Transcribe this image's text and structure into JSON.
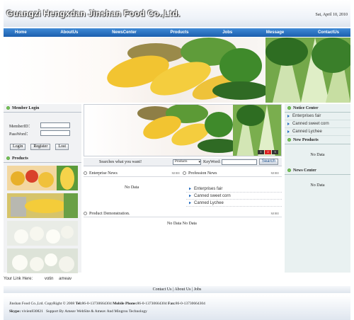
{
  "header": {
    "site_title": "Guangzi Hengxdan Jinshan Food Co.,Ltd.",
    "date": "Sat, April 10, 2010"
  },
  "nav": [
    "Home",
    "AboutUs",
    "NewsCenter",
    "Products",
    "Jobs",
    "Message",
    "ContactUs"
  ],
  "member_login": {
    "title": "Member Login",
    "member_id_label": "MemberID：",
    "password_label": "PassWord：",
    "login_button": "Login",
    "register_button": "Register",
    "lost_button": "Lost"
  },
  "products": {
    "title": "Products"
  },
  "slider": {
    "dots": [
      "1",
      "2",
      "3"
    ],
    "active": "2"
  },
  "search": {
    "label": "Searches what you want!",
    "category_selected": "Products",
    "keyword_label": "KeyWord:",
    "button": "Search"
  },
  "enterprise_news": {
    "title": "Enterprise News",
    "more": "MORE",
    "empty": "No Data"
  },
  "profession_news": {
    "title": "Profession News",
    "more": "MORE",
    "items": [
      "Enterprises fair",
      "Canned sweet corn",
      "Canned Lychee"
    ]
  },
  "product_demonstration": {
    "title": "Product Demonstration.",
    "more": "MORE",
    "empty": "No Data No Data"
  },
  "notice_center": {
    "title": "Notice Center",
    "items": [
      "Enterprises fair",
      "Canned sweet corn",
      "Canned Lychee"
    ]
  },
  "new_products": {
    "title": "New Products",
    "empty": "No Data"
  },
  "news_center": {
    "title": "News Center",
    "empty": "No Data"
  },
  "your_link": {
    "label": "Your Link Here:",
    "links": [
      "votin",
      "ameav"
    ]
  },
  "footer_links": "Contact Us | About Us | Jobs",
  "footer": {
    "copyright_prefix": "Jinshan Food Co.,Ltd. CopyRight © 2008",
    "tel_label": "Tel:",
    "tel": "86-0-13730664304",
    "mobile_label": "Mobile Phone:",
    "mobile": "86-0-13730664304",
    "fax_label": "Fax:",
    "fax": "86-0-13730664304",
    "skype_label": "Skype:",
    "skype": "vivien830821",
    "support": "Support By Ameav WebSite & Ameav And Mingrou Technology"
  },
  "colors": {
    "nav": "#1c5fae",
    "accent_green": "#3a8f26",
    "right_bg": "#e9f1f1",
    "left_bg": "#f1f2f4"
  }
}
